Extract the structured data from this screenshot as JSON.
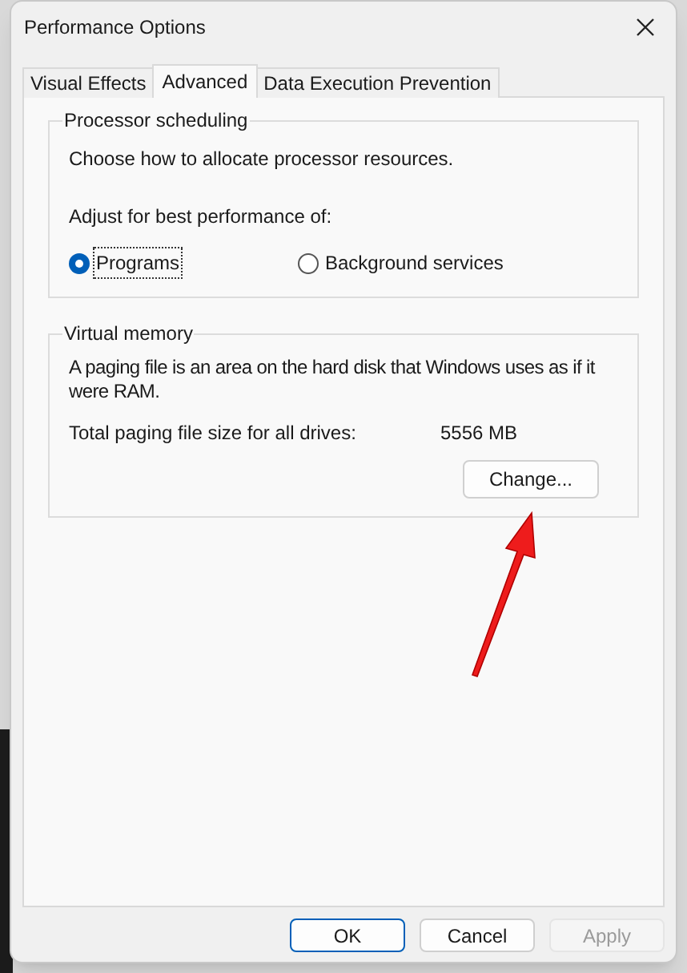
{
  "window": {
    "title": "Performance Options"
  },
  "tabs": [
    {
      "label": "Visual Effects",
      "selected": false
    },
    {
      "label": "Advanced",
      "selected": true
    },
    {
      "label": "Data Execution Prevention",
      "selected": false
    }
  ],
  "processor_scheduling": {
    "title": "Processor scheduling",
    "description": "Choose how to allocate processor resources.",
    "prompt": "Adjust for best performance of:",
    "options": [
      {
        "label": "Programs",
        "selected": true
      },
      {
        "label": "Background services",
        "selected": false
      }
    ]
  },
  "virtual_memory": {
    "title": "Virtual memory",
    "description": "A paging file is an area on the hard disk that Windows uses as if it were RAM.",
    "total_label": "Total paging file size for all drives:",
    "total_value": "5556 MB",
    "change_button": "Change..."
  },
  "buttons": [
    {
      "label": "OK",
      "default": true,
      "disabled": false
    },
    {
      "label": "Cancel",
      "default": false,
      "disabled": false
    },
    {
      "label": "Apply",
      "default": false,
      "disabled": true
    }
  ]
}
